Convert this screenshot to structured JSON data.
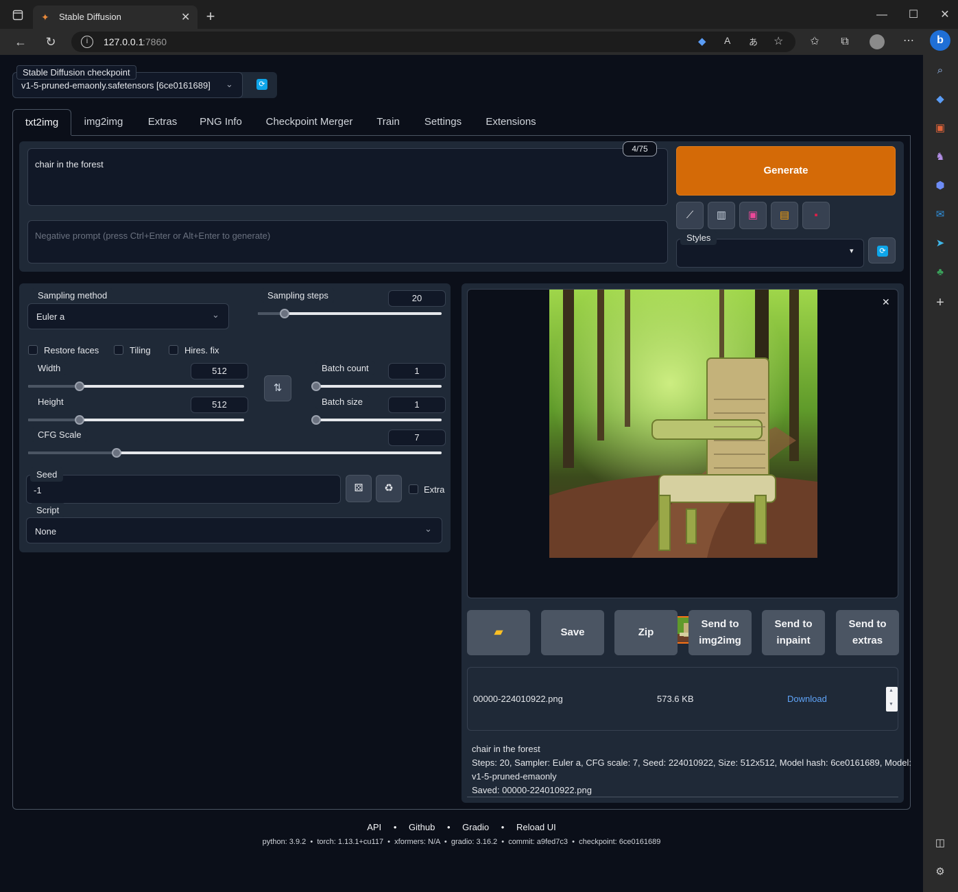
{
  "browser": {
    "tab_title": "Stable Diffusion",
    "url_host": "127.0.0.1",
    "url_port": ":7860"
  },
  "checkpoint": {
    "label": "Stable Diffusion checkpoint",
    "value": "v1-5-pruned-emaonly.safetensors [6ce0161689]"
  },
  "tabs": [
    "txt2img",
    "img2img",
    "Extras",
    "PNG Info",
    "Checkpoint Merger",
    "Train",
    "Settings",
    "Extensions"
  ],
  "prompt": {
    "value": "chair in the forest",
    "token_count": "4/75",
    "negative_placeholder": "Negative prompt (press Ctrl+Enter or Alt+Enter to generate)"
  },
  "generate_label": "Generate",
  "styles_label": "Styles",
  "params": {
    "sampling_method_label": "Sampling method",
    "sampling_method": "Euler a",
    "sampling_steps_label": "Sampling steps",
    "sampling_steps": "20",
    "restore_faces": "Restore faces",
    "tiling": "Tiling",
    "hires_fix": "Hires. fix",
    "width_label": "Width",
    "width": "512",
    "height_label": "Height",
    "height": "512",
    "batch_count_label": "Batch count",
    "batch_count": "1",
    "batch_size_label": "Batch size",
    "batch_size": "1",
    "cfg_label": "CFG Scale",
    "cfg": "7",
    "seed_label": "Seed",
    "seed": "-1",
    "extra_label": "Extra",
    "script_label": "Script",
    "script": "None"
  },
  "actions": {
    "save": "Save",
    "zip": "Zip",
    "send_img2img_1": "Send to",
    "send_img2img_2": "img2img",
    "send_inpaint_1": "Send to",
    "send_inpaint_2": "inpaint",
    "send_extras_1": "Send to",
    "send_extras_2": "extras"
  },
  "file": {
    "name": "00000-224010922.png",
    "size": "573.6 KB",
    "download": "Download"
  },
  "info": {
    "line1": "chair in the forest",
    "line2": "Steps: 20, Sampler: Euler a, CFG scale: 7, Seed: 224010922, Size: 512x512, Model hash: 6ce0161689, Model:",
    "line3": "v1-5-pruned-emaonly",
    "line4": "Saved: 00000-224010922.png"
  },
  "footer": {
    "links": [
      "API",
      "Github",
      "Gradio",
      "Reload UI"
    ],
    "versions": "python: 3.9.2  •  torch: 1.13.1+cu117  •  xformers: N/A  •  gradio: 3.16.2  •  commit: a9fed7c3  •  checkpoint: 6ce0161689"
  },
  "colors": {
    "accent": "#d46a07",
    "page_bg": "#0b0f19",
    "panel_bg": "#1f2937"
  }
}
